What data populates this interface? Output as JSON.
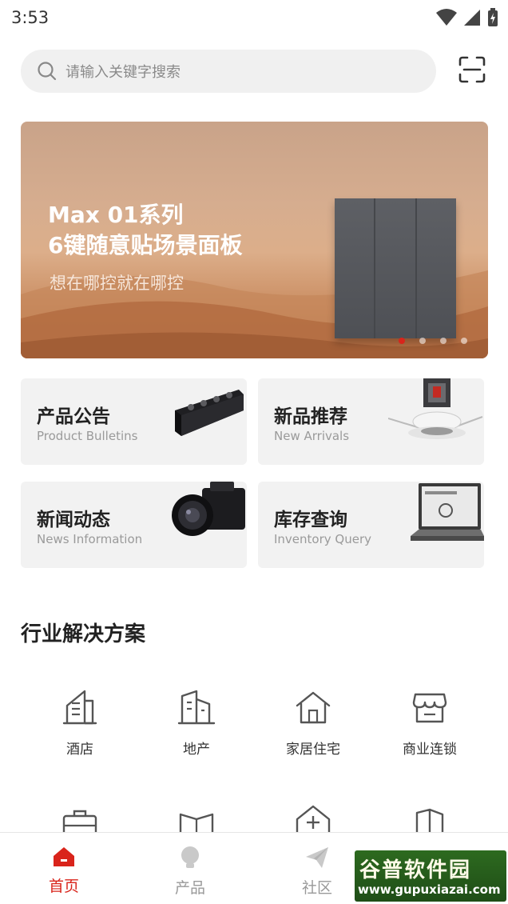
{
  "status_bar": {
    "time": "3:53"
  },
  "search": {
    "placeholder": "请输入关键字搜索"
  },
  "banner": {
    "title_line1": "Max 01系列",
    "title_line2": "6键随意贴场景面板",
    "subtitle": "想在哪控就在哪控",
    "slide_count": 4,
    "active_slide": 1
  },
  "quick_cards": [
    {
      "title": "产品公告",
      "subtitle": "Product Bulletins"
    },
    {
      "title": "新品推荐",
      "subtitle": "New Arrivals"
    },
    {
      "title": "新闻动态",
      "subtitle": "News Information"
    },
    {
      "title": "库存查询",
      "subtitle": "Inventory Query"
    }
  ],
  "solutions": {
    "title": "行业解决方案",
    "items": [
      {
        "label": "酒店",
        "icon": "hotel-building-icon"
      },
      {
        "label": "地产",
        "icon": "real-estate-buildings-icon"
      },
      {
        "label": "家居住宅",
        "icon": "house-icon"
      },
      {
        "label": "商业连锁",
        "icon": "store-icon"
      }
    ]
  },
  "bottom_nav": {
    "items": [
      {
        "label": "首页",
        "icon": "home-icon",
        "active": true
      },
      {
        "label": "产品",
        "icon": "bulb-icon",
        "active": false
      },
      {
        "label": "社区",
        "icon": "send-icon",
        "active": false
      }
    ]
  },
  "watermark": {
    "top": "谷普软件园",
    "bottom": "www.gupuxiazai.com"
  },
  "colors": {
    "accent": "#d9241b",
    "card_bg": "#f2f2f2",
    "search_bg": "#f0f0f0"
  }
}
